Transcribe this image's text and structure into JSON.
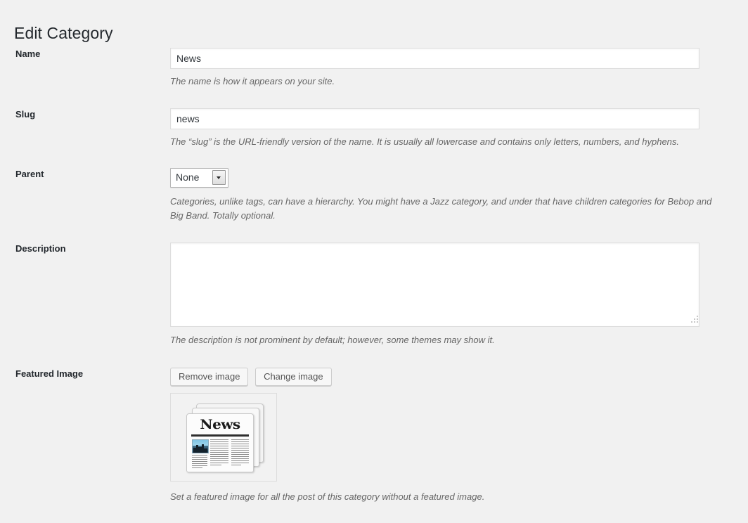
{
  "page": {
    "title": "Edit Category"
  },
  "fields": {
    "name": {
      "label": "Name",
      "value": "News",
      "placeholder": "",
      "description": "The name is how it appears on your site."
    },
    "slug": {
      "label": "Slug",
      "value": "news",
      "placeholder": "",
      "description": "The “slug” is the URL-friendly version of the name. It is usually all lowercase and contains only letters, numbers, and hyphens."
    },
    "parent": {
      "label": "Parent",
      "selected": "None",
      "options": [
        "None"
      ],
      "description": "Categories, unlike tags, can have a hierarchy. You might have a Jazz category, and under that have children categories for Bebop and Big Band. Totally optional."
    },
    "description": {
      "label": "Description",
      "value": "",
      "placeholder": "",
      "description": "The description is not prominent by default; however, some themes may show it."
    },
    "featured_image": {
      "label": "Featured Image",
      "remove_button": "Remove image",
      "change_button": "Change image",
      "thumbnail_alt": "newspaper-stack-thumbnail",
      "thumbnail_masthead": "News",
      "description": "Set a featured image for all the post of this category without a featured image."
    }
  },
  "colors": {
    "page_background": "#f1f1f1",
    "label_text": "#23282d",
    "help_text": "#666666",
    "input_border": "#dddddd",
    "input_background": "#ffffff",
    "button_background": "#f7f7f7",
    "button_border": "#cccccc"
  }
}
